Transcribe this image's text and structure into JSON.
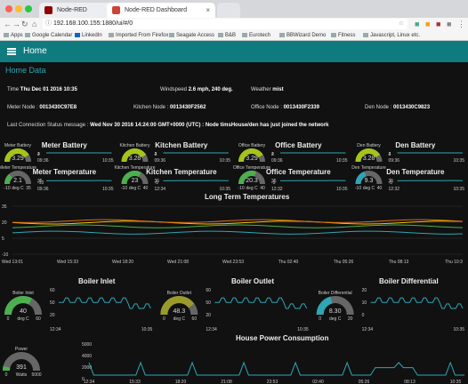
{
  "browser": {
    "tabs": [
      {
        "label": "Node-RED"
      },
      {
        "label": "Node-RED Dashboard"
      }
    ],
    "url": "192.168.100.155:1880/ui/#/0",
    "bookmarks": [
      "Apps",
      "Google Calendar",
      "LinkedIn",
      "Imported From Firefox",
      "Seagate Access",
      "B&B",
      "Eurotech",
      "BBWizard Demo",
      "Fitness",
      "Javascript, Linux etc."
    ]
  },
  "app": {
    "title": "Home",
    "group_title": "Home Data"
  },
  "info": {
    "time_label": "Time",
    "time_value": "Thu Dec 01 2016 10:35",
    "wind_label": "Windspeed",
    "wind_value": "2.6 mph, 240 deg.",
    "weather_label": "Weather",
    "weather_value": "mist",
    "meter_label": "Meter Node :",
    "meter_value": "0013430C97E8",
    "kitchen_label": "Kitchen Node :",
    "kitchen_value": "0013430F2562",
    "office_label": "Office Node :",
    "office_value": "0013430F2339",
    "den_label": "Den Node :",
    "den_value": "0013430C9823",
    "status_label": "Last Connection Status message :",
    "status_value": "Wed Nov 30 2016 14:24:00 GMT+0000 (UTC) : Node timsHouse/den has just joined the network"
  },
  "battery": [
    {
      "title": "Meter Battery",
      "gauge_label": "Meter Battery",
      "value": "3.29",
      "unit": "Volts",
      "min": "0",
      "max": "4",
      "fill": 0.82,
      "color": "#a5c41a",
      "y_ticks": [
        "4",
        "2"
      ],
      "x_ticks": [
        "09:36",
        "10:35"
      ]
    },
    {
      "title": "Kitchen Battery",
      "gauge_label": "Kitchen Battery",
      "value": "3.28",
      "unit": "Kitchen Battery",
      "min": "0",
      "max": "4",
      "fill": 0.82,
      "color": "#a5c41a",
      "y_ticks": [
        "4",
        "2"
      ],
      "x_ticks": [
        "09:36",
        "10:35"
      ]
    },
    {
      "title": "Office Battery",
      "gauge_label": "Office Battery",
      "value": "3.29",
      "unit": "Office Battery",
      "min": "0",
      "max": "4",
      "fill": 0.82,
      "color": "#a5c41a",
      "y_ticks": [
        "4",
        "2"
      ],
      "x_ticks": [
        "09:36",
        "10:35"
      ]
    },
    {
      "title": "Den Battery",
      "gauge_label": "Den Battery",
      "value": "3.28",
      "unit": "Volts",
      "min": "0",
      "max": "4",
      "fill": 0.82,
      "color": "#a5c41a",
      "y_ticks": [
        "4",
        "2"
      ],
      "x_ticks": [
        "09:36",
        "10:35"
      ]
    }
  ],
  "temperature": [
    {
      "title": "Meter Temperature",
      "gauge_label": "Meter Temperature",
      "value": "2.1",
      "unit": "deg C",
      "min": "-10",
      "max": "35",
      "fill": 0.27,
      "color": "#4caf50",
      "y_ticks": [
        "35",
        "-10"
      ],
      "x_ticks": [
        "09:36",
        "10:35"
      ]
    },
    {
      "title": "Kitchen Temperature",
      "gauge_label": "Kitchen Temperature",
      "value": "23",
      "unit": "deg C",
      "min": "-10",
      "max": "40",
      "fill": 0.66,
      "color": "#4caf50",
      "y_ticks": [
        "35",
        "-5"
      ],
      "x_ticks": [
        "12:34",
        "10:35"
      ]
    },
    {
      "title": "Office Temperature",
      "gauge_label": "Office Temperature",
      "value": "20.3",
      "unit": "deg C",
      "min": "-10",
      "max": "40",
      "fill": 0.61,
      "color": "#4caf50",
      "y_ticks": [
        "35",
        "-5"
      ],
      "x_ticks": [
        "12:32",
        "10:35"
      ]
    },
    {
      "title": "Den Temperature",
      "gauge_label": "Den Temperature",
      "value": "9.3",
      "unit": "deg C",
      "min": "-10",
      "max": "40",
      "fill": 0.39,
      "color": "#2ea6b5",
      "y_ticks": [
        "35",
        "-5"
      ],
      "x_ticks": [
        "12:32",
        "10:35"
      ]
    }
  ],
  "long_term": {
    "title": "Long Term Temperatures",
    "y_ticks": [
      "35",
      "20",
      "5",
      "-10"
    ],
    "x_ticks": [
      "Wed 13:01",
      "Wed 15:33",
      "Wed 18:20",
      "Wed 21:08",
      "Wed 23:53",
      "Thu 02:40",
      "Thu 05:26",
      "Thu 08:13",
      "Thu 10:3"
    ]
  },
  "boiler": [
    {
      "title": "Boiler Inlet",
      "gauge_label": "Boiler Inlet",
      "value": "40",
      "unit": "deg C",
      "min": "0",
      "max": "60",
      "fill": 0.66,
      "color": "#4caf50",
      "y_ticks": [
        "60",
        "50",
        "20"
      ],
      "x_ticks": [
        "12:34",
        "10:35"
      ]
    },
    {
      "title": "Boiler Outlet",
      "gauge_label": "Boiler Outlet",
      "value": "48.3",
      "unit": "deg C",
      "min": "0",
      "max": "60",
      "fill": 0.8,
      "color": "#9a9a2a",
      "y_ticks": [
        "60",
        "50",
        "20"
      ],
      "x_ticks": [
        "12:34",
        "10:35"
      ]
    },
    {
      "title": "Boiler Differential",
      "gauge_label": "Boiler Differential",
      "value": "8.30",
      "unit": "deg C",
      "min": "0",
      "max": "20",
      "fill": 0.42,
      "color": "#2ea6b5",
      "y_ticks": [
        "20",
        "10",
        "0"
      ],
      "x_ticks": [
        "12:34",
        "10:35"
      ]
    }
  ],
  "power": {
    "gauge_label": "Power",
    "value": "391",
    "unit": "Watts",
    "min": "0",
    "max": "5000",
    "fill": 0.08,
    "color": "#4caf50",
    "title": "House Power Consumption",
    "y_ticks": [
      "5000",
      "4000",
      "2000",
      "0"
    ],
    "x_ticks": [
      "12:34",
      "15:33",
      "18:20",
      "21:08",
      "23:53",
      "02:40",
      "05:26",
      "08:13",
      "10:35"
    ]
  }
}
